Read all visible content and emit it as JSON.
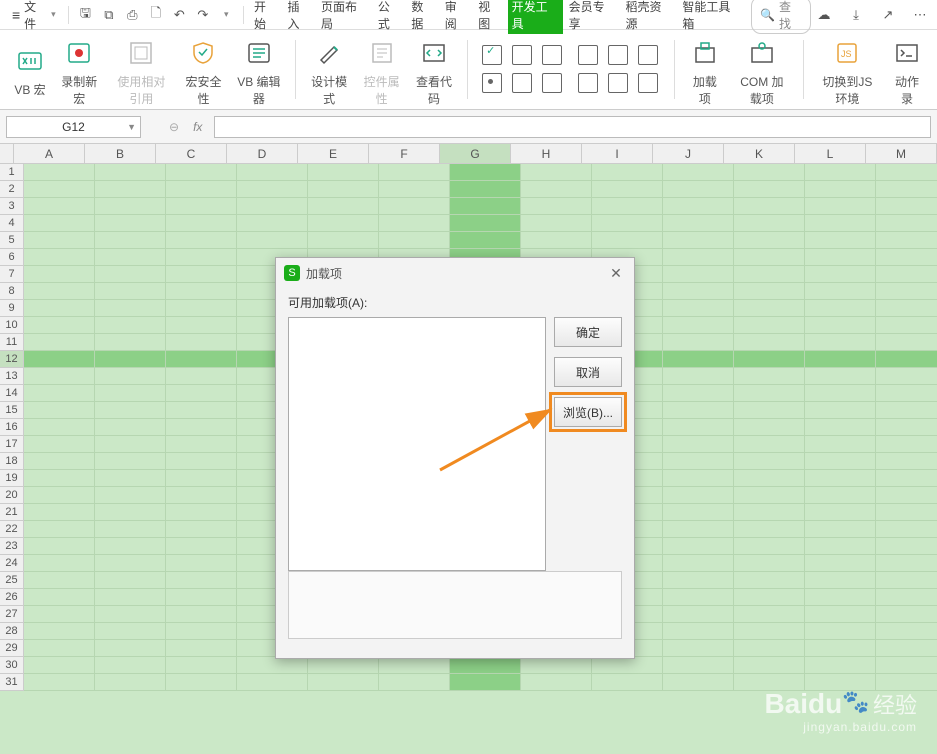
{
  "menubar": {
    "file_label": "文件",
    "tabs": [
      "开始",
      "插入",
      "页面布局",
      "公式",
      "数据",
      "审阅",
      "视图",
      "开发工具",
      "会员专享",
      "稻壳资源",
      "智能工具箱"
    ],
    "active_tab_index": 7,
    "search_placeholder": "查找"
  },
  "ribbon": {
    "items": [
      {
        "label": "VB 宏",
        "icon": "vb"
      },
      {
        "label": "录制新宏",
        "icon": "rec"
      },
      {
        "label": "使用相对引用",
        "icon": "rel",
        "disabled": true
      },
      {
        "label": "宏安全性",
        "icon": "sec"
      },
      {
        "label": "VB 编辑器",
        "icon": "editor"
      },
      {
        "label": "设计模式",
        "icon": "design"
      },
      {
        "label": "控件属性",
        "icon": "prop",
        "disabled": true
      },
      {
        "label": "查看代码",
        "icon": "code"
      },
      {
        "label": "加载项",
        "icon": "addin"
      },
      {
        "label": "COM 加载项",
        "icon": "com"
      },
      {
        "label": "切换到JS环境",
        "icon": "js"
      },
      {
        "label": "动作录",
        "icon": "act"
      }
    ]
  },
  "fx": {
    "cell_ref": "G12",
    "fx_symbol": "fx"
  },
  "columns": [
    "A",
    "B",
    "C",
    "D",
    "E",
    "F",
    "G",
    "H",
    "I",
    "J",
    "K",
    "L",
    "M"
  ],
  "row_count": 31,
  "selected_row": 12,
  "selected_col": "G",
  "dialog": {
    "title": "加载项",
    "available_label": "可用加载项(A):",
    "ok": "确定",
    "cancel": "取消",
    "browse": "浏览(B)..."
  },
  "watermark": {
    "brand": "Baidu",
    "sub": "经验",
    "url": "jingyan.baidu.com"
  }
}
